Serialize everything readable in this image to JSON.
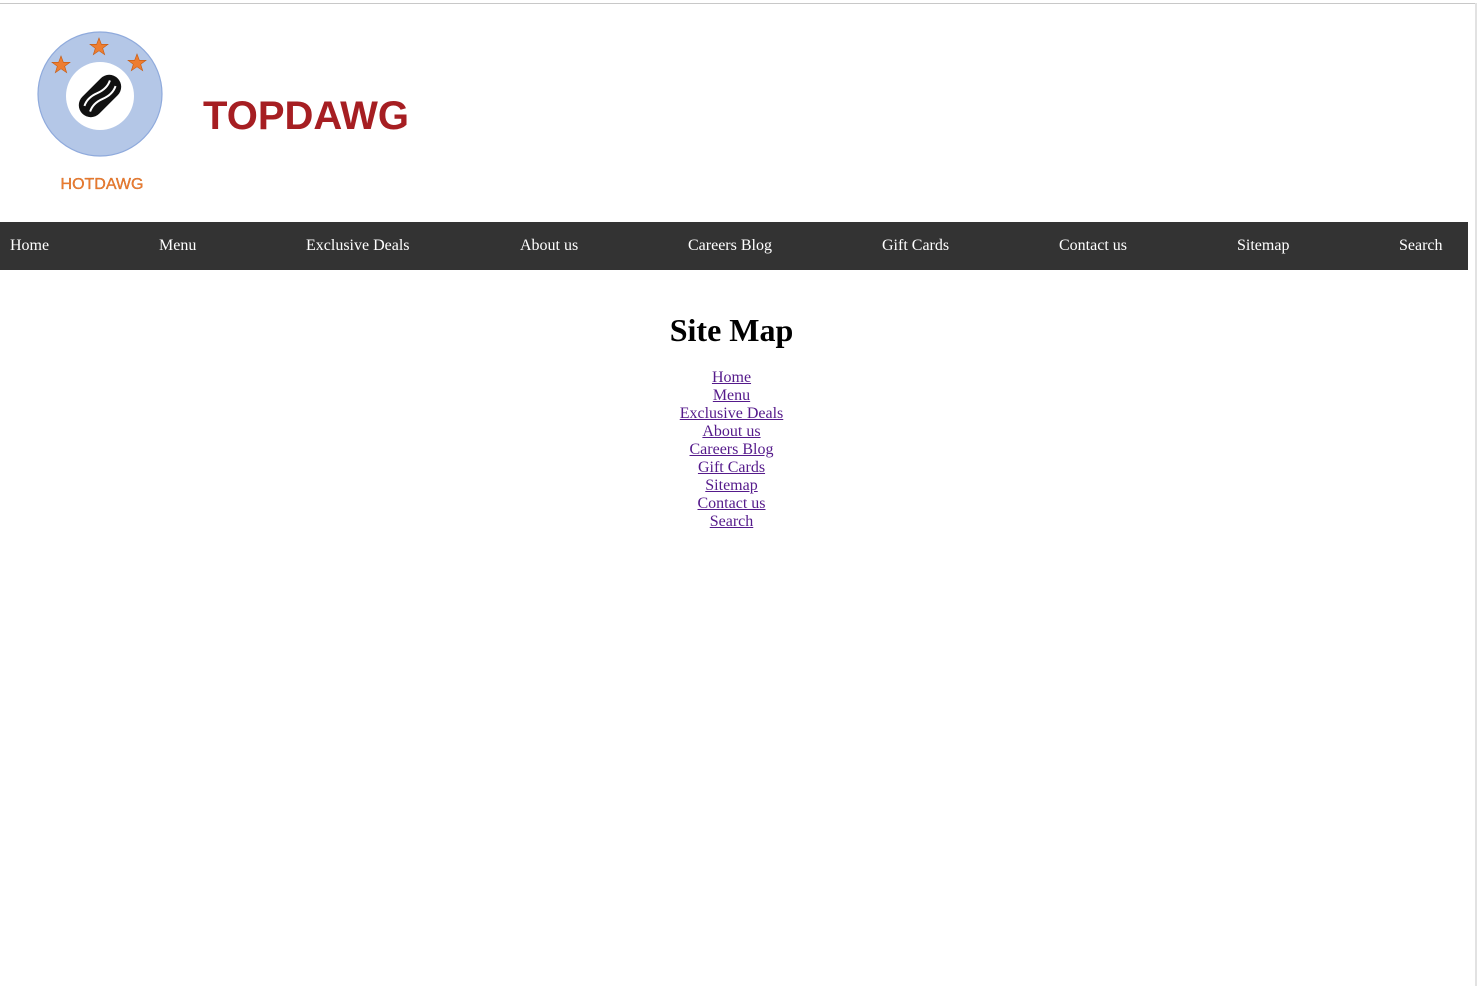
{
  "brand": {
    "logo_text": "HOTDAWG",
    "site_title": "TOPDAWG",
    "colors": {
      "title": "#a61e22",
      "logo_ring": "#b4c7e7",
      "logo_ring_stroke": "#8faadc",
      "logo_stars": "#ed7d31",
      "logo_text": "#ed7d31"
    },
    "logo_icon": "hotdog-icon"
  },
  "nav": {
    "background": "#333333",
    "items": [
      {
        "label": "Home"
      },
      {
        "label": "Menu"
      },
      {
        "label": "Exclusive Deals"
      },
      {
        "label": "About us"
      },
      {
        "label": "Careers Blog"
      },
      {
        "label": "Gift Cards"
      },
      {
        "label": "Contact us"
      },
      {
        "label": "Sitemap"
      },
      {
        "label": "Search"
      }
    ]
  },
  "main": {
    "heading": "Site Map",
    "links": [
      {
        "label": "Home"
      },
      {
        "label": "Menu"
      },
      {
        "label": "Exclusive Deals"
      },
      {
        "label": "About us"
      },
      {
        "label": "Careers Blog"
      },
      {
        "label": "Gift Cards"
      },
      {
        "label": "Sitemap"
      },
      {
        "label": "Contact us"
      },
      {
        "label": "Search"
      }
    ],
    "link_color": "#551a8b"
  }
}
